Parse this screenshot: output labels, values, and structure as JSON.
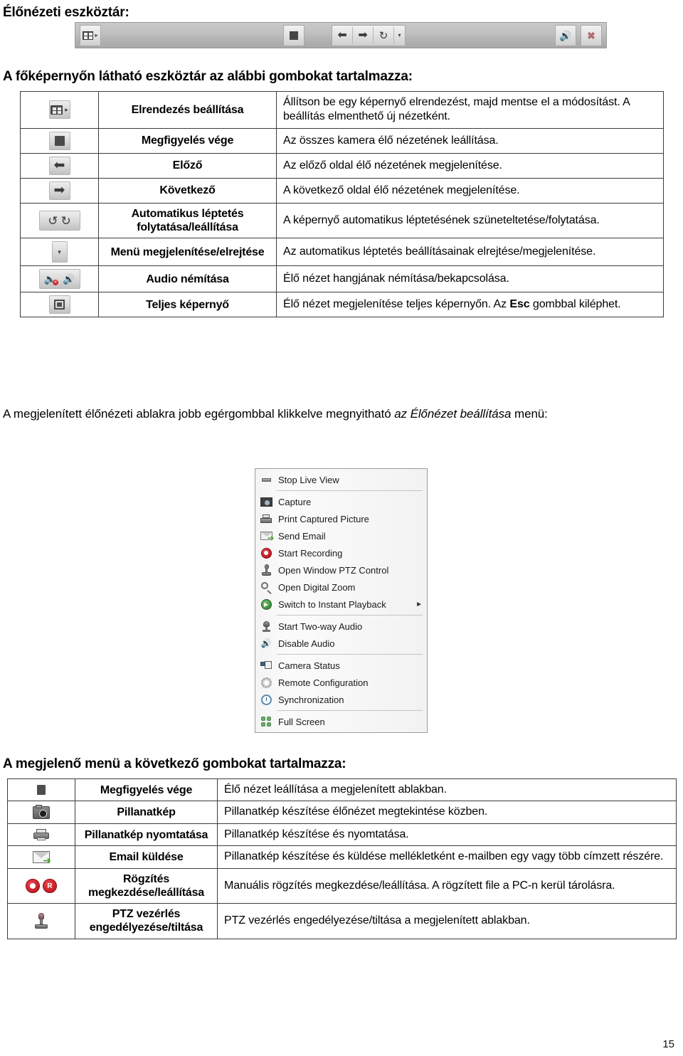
{
  "headings": {
    "live_toolbar": "Élőnézeti eszköztár:",
    "toolbar_buttons_intro": "A főképernyőn látható eszköztár az alábbi gombokat tartalmazza:",
    "menu_buttons_intro": "A megjelenő menü a következő gombokat tartalmazza:"
  },
  "toolbar_mock": {
    "buttons": [
      {
        "name": "layout-settings-button",
        "icon": "layout-icon"
      },
      {
        "name": "stop-live-view-button",
        "icon": "stop-icon"
      },
      {
        "name": "previous-page-button",
        "icon": "arrow-left-icon"
      },
      {
        "name": "next-page-button",
        "icon": "arrow-right-icon"
      },
      {
        "name": "auto-switch-button",
        "icon": "refresh-icon"
      },
      {
        "name": "show-hide-menu-button",
        "icon": "caret-down-icon"
      },
      {
        "name": "mute-audio-button",
        "icon": "speaker-mute-icon"
      },
      {
        "name": "full-screen-button",
        "icon": "full-screen-icon"
      }
    ]
  },
  "paragraph_right_click": {
    "before": "A megjelenített élőnézeti ablakra jobb egérgombbal klikkelve megnyitható ",
    "italic": "az Élőnézet beállítása",
    "after": " menü:"
  },
  "toolbar_table": {
    "rows": [
      {
        "icon": "layout-icon",
        "name": "Elrendezés beállítása",
        "desc": "Állítson be egy képernyő elrendezést, majd mentse el a módosítást. A beállítás elmenthető új nézetként."
      },
      {
        "icon": "stop-icon",
        "name": "Megfigyelés vége",
        "desc": "Az összes kamera élő nézetének leállítása."
      },
      {
        "icon": "arrow-left-icon",
        "name": "Előző",
        "desc": "Az előző oldal élő nézetének megjelenítése."
      },
      {
        "icon": "arrow-right-icon",
        "name": "Következő",
        "desc": "A következő oldal élő nézetének megjelenítése."
      },
      {
        "icon": "auto-switch-icon",
        "name": "Automatikus léptetés folytatása/leállítása",
        "desc": "A képernyő automatikus léptetésének szüneteltetése/folytatása."
      },
      {
        "icon": "caret-down-icon",
        "name": "Menü megjelenítése/elrejtése",
        "desc": "Az automatikus léptetés beállításainak elrejtése/megjelenítése."
      },
      {
        "icon": "speaker-mute-icon",
        "name": "Audio némítása",
        "desc": "Élő nézet hangjának némítása/bekapcsolása."
      },
      {
        "icon": "full-screen-icon",
        "name": "Teljes képernyő",
        "desc_before": "Élő nézet megjelenítése teljes képernyőn. Az ",
        "desc_bold": "Esc",
        "desc_after": " gombbal kiléphet."
      }
    ]
  },
  "context_menu": {
    "items": [
      {
        "icon": "stop-live-view-icon",
        "label": "Stop Live View",
        "submenu": false,
        "separator_after": true
      },
      {
        "icon": "capture-icon",
        "label": "Capture",
        "submenu": false,
        "separator_after": false
      },
      {
        "icon": "print-icon",
        "label": "Print Captured Picture",
        "submenu": false,
        "separator_after": false
      },
      {
        "icon": "send-email-icon",
        "label": "Send Email",
        "submenu": false,
        "separator_after": false
      },
      {
        "icon": "start-recording-icon",
        "label": "Start Recording",
        "submenu": false,
        "separator_after": false
      },
      {
        "icon": "ptz-control-icon",
        "label": "Open Window PTZ Control",
        "submenu": false,
        "separator_after": false
      },
      {
        "icon": "digital-zoom-icon",
        "label": "Open Digital Zoom",
        "submenu": false,
        "separator_after": false
      },
      {
        "icon": "instant-playback-icon",
        "label": "Switch to Instant Playback",
        "submenu": true,
        "separator_after": true
      },
      {
        "icon": "two-way-audio-icon",
        "label": "Start Two-way Audio",
        "submenu": false,
        "separator_after": false
      },
      {
        "icon": "disable-audio-icon",
        "label": "Disable Audio",
        "submenu": false,
        "separator_after": true
      },
      {
        "icon": "camera-status-icon",
        "label": "Camera Status",
        "submenu": false,
        "separator_after": false
      },
      {
        "icon": "remote-configuration-icon",
        "label": "Remote Configuration",
        "submenu": false,
        "separator_after": false
      },
      {
        "icon": "synchronization-icon",
        "label": "Synchronization",
        "submenu": false,
        "separator_after": true
      },
      {
        "icon": "full-screen-icon",
        "label": "Full Screen",
        "submenu": false,
        "separator_after": false
      }
    ],
    "submenu_arrow": "►"
  },
  "menu_table": {
    "rows": [
      {
        "icon": "stop-icon",
        "name": "Megfigyelés vége",
        "desc": "Élő nézet leállítása a megjelenített ablakban."
      },
      {
        "icon": "capture-icon",
        "name": "Pillanatkép",
        "desc": "Pillanatkép készítése élőnézet megtekintése közben."
      },
      {
        "icon": "print-icon",
        "name": "Pillanatkép nyomtatása",
        "desc": "Pillanatkép készítése és nyomtatása."
      },
      {
        "icon": "send-email-icon",
        "name": "Email küldése",
        "desc": "Pillanatkép készítése és küldése mellékletként e-mailben egy vagy több címzett részére."
      },
      {
        "icon": "record-icon",
        "name": "Rögzítés megkezdése/leállítása",
        "desc": "Manuális rögzítés megkezdése/leállítása. A rögzített file a PC-n kerül tárolásra."
      },
      {
        "icon": "ptz-control-icon",
        "name": "PTZ vezérlés engedélyezése/tiltása",
        "desc": "PTZ vezérlés engedélyezése/tiltása a megjelenített ablakban."
      }
    ]
  },
  "page_number": "15",
  "colors": {
    "record_red": "#b80d16",
    "email_green": "#4f9f33",
    "full_screen_green": "#6fa86f",
    "table_border": "#3c3c3c"
  }
}
